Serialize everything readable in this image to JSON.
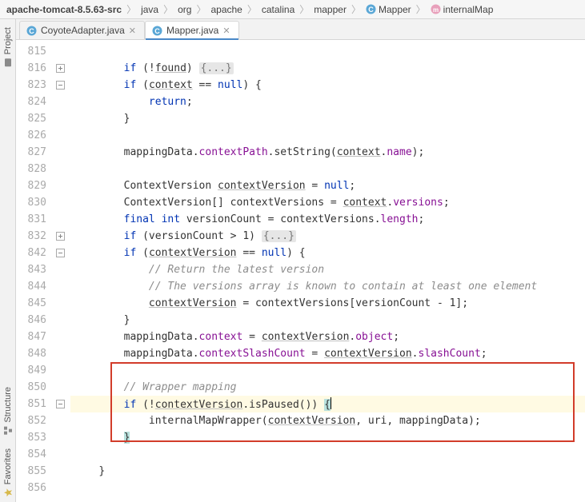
{
  "breadcrumb": {
    "items": [
      {
        "label": "apache-tomcat-8.5.63-src",
        "bold": true,
        "icon": "folder"
      },
      {
        "label": "java",
        "icon": "folder"
      },
      {
        "label": "org",
        "icon": "folder"
      },
      {
        "label": "apache",
        "icon": "folder"
      },
      {
        "label": "catalina",
        "icon": "folder"
      },
      {
        "label": "mapper",
        "icon": "folder"
      },
      {
        "label": "Mapper",
        "icon": "class"
      },
      {
        "label": "internalMap",
        "icon": "method"
      }
    ]
  },
  "side": {
    "project": "Project",
    "structure": "Structure",
    "favorites": "Favorites"
  },
  "tabs": {
    "inactive": "CoyoteAdapter.java",
    "active": "Mapper.java"
  },
  "gutter": [
    "815",
    "816",
    "823",
    "824",
    "825",
    "826",
    "827",
    "828",
    "829",
    "830",
    "831",
    "832",
    "842",
    "843",
    "844",
    "845",
    "846",
    "847",
    "848",
    "849",
    "850",
    "851",
    "852",
    "853",
    "854",
    "855",
    "856"
  ],
  "code": {
    "l0": "",
    "l1a": "if",
    "l1b": " (!",
    "l1c": "found",
    "l1d": ") ",
    "l1e": "{...}",
    "l2a": "if",
    "l2b": " (",
    "l2c": "context",
    "l2d": " == ",
    "l2e": "null",
    "l2f": ") {",
    "l3a": "return",
    "l3b": ";",
    "l4": "}",
    "l5": "",
    "l6a": "mappingData.",
    "l6b": "contextPath",
    "l6c": ".setString(",
    "l6d": "context",
    "l6e": ".",
    "l6f": "name",
    "l6g": ");",
    "l7": "",
    "l8a": "ContextVersion ",
    "l8b": "contextVersion",
    "l8c": " = ",
    "l8d": "null",
    "l8e": ";",
    "l9a": "ContextVersion[] contextVersions = ",
    "l9b": "context",
    "l9c": ".",
    "l9d": "versions",
    "l9e": ";",
    "l10a": "final int",
    "l10b": " versionCount = contextVersions.",
    "l10c": "length",
    "l10d": ";",
    "l11a": "if",
    "l11b": " (versionCount > 1) ",
    "l11c": "{...}",
    "l12a": "if",
    "l12b": " (",
    "l12c": "contextVersion",
    "l12d": " == ",
    "l12e": "null",
    "l12f": ") {",
    "l13": "// Return the latest version",
    "l14": "// The versions array is known to contain at least one element",
    "l15a": "contextVersion",
    "l15b": " = contextVersions[versionCount - 1];",
    "l16": "}",
    "l17a": "mappingData.",
    "l17b": "context",
    "l17c": " = ",
    "l17d": "contextVersion",
    "l17e": ".",
    "l17f": "object",
    "l17g": ";",
    "l18a": "mappingData.",
    "l18b": "contextSlashCount",
    "l18c": " = ",
    "l18d": "contextVersion",
    "l18e": ".",
    "l18f": "slashCount",
    "l18g": ";",
    "l19": "",
    "l20": "// Wrapper mapping",
    "l21a": "if",
    "l21b": " (!",
    "l21c": "contextVersion",
    "l21d": ".isPaused()) ",
    "l21e": "{",
    "l22a": "internalMapWrapper(",
    "l22b": "contextVersion",
    "l22c": ", uri, mappingData);",
    "l23": "}",
    "l24": "",
    "l25": "}",
    "l26": ""
  },
  "indent": {
    "i2": "        ",
    "i3": "            ",
    "i4": "                ",
    "i1": "    "
  },
  "colors": {
    "keyword": "#0033b3",
    "field": "#871094",
    "comment": "#8c8c8c",
    "highlightBox": "#d23c2a",
    "bracePair": "#b8e0dc",
    "currentLine": "#fffae3"
  }
}
